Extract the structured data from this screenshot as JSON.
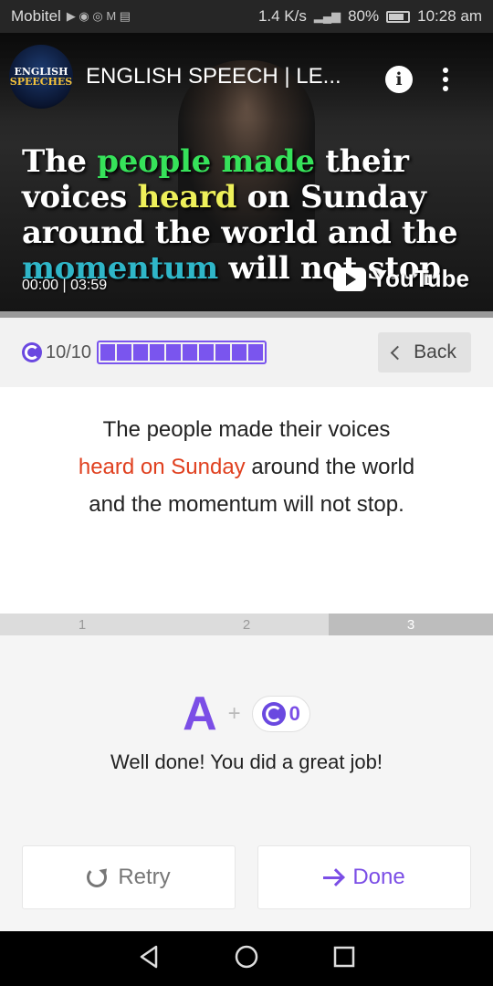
{
  "status_bar": {
    "carrier": "Mobitel",
    "speed": "1.4 K/s",
    "battery": "80%",
    "time": "10:28 am"
  },
  "video": {
    "channel_logo_line1": "ENGLISH",
    "channel_logo_line2": "SPEECHES",
    "title": "ENGLISH SPEECH | LE...",
    "caption": {
      "line1_white": "The ",
      "line1_green": "people made",
      "line1_white2": " their",
      "line2_white": "voices ",
      "line2_yellow": "heard",
      "line2_white2": " on Sunday",
      "line3": "around the world and the",
      "line4_cyan": "momentum",
      "line4_white": " will not stop"
    },
    "time": "00:00 | 03:59",
    "youtube_label": "YouTube",
    "progress": 0.0
  },
  "lesson": {
    "score": "10/10",
    "segments_filled": 10,
    "back_label": "Back"
  },
  "sentence": {
    "line1": "The people made their voices",
    "highlight": "heard on Sunday",
    "line2_rest": " around the world",
    "line3": "and the momentum will not stop."
  },
  "steps": [
    "1",
    "2",
    "3"
  ],
  "active_step": 3,
  "result": {
    "grade": "A",
    "plus": "+",
    "coins": "0",
    "message": "Well done! You did a great job!"
  },
  "buttons": {
    "retry": "Retry",
    "done": "Done"
  },
  "colors": {
    "accent": "#7b4ee6",
    "highlight": "#e0401f"
  }
}
